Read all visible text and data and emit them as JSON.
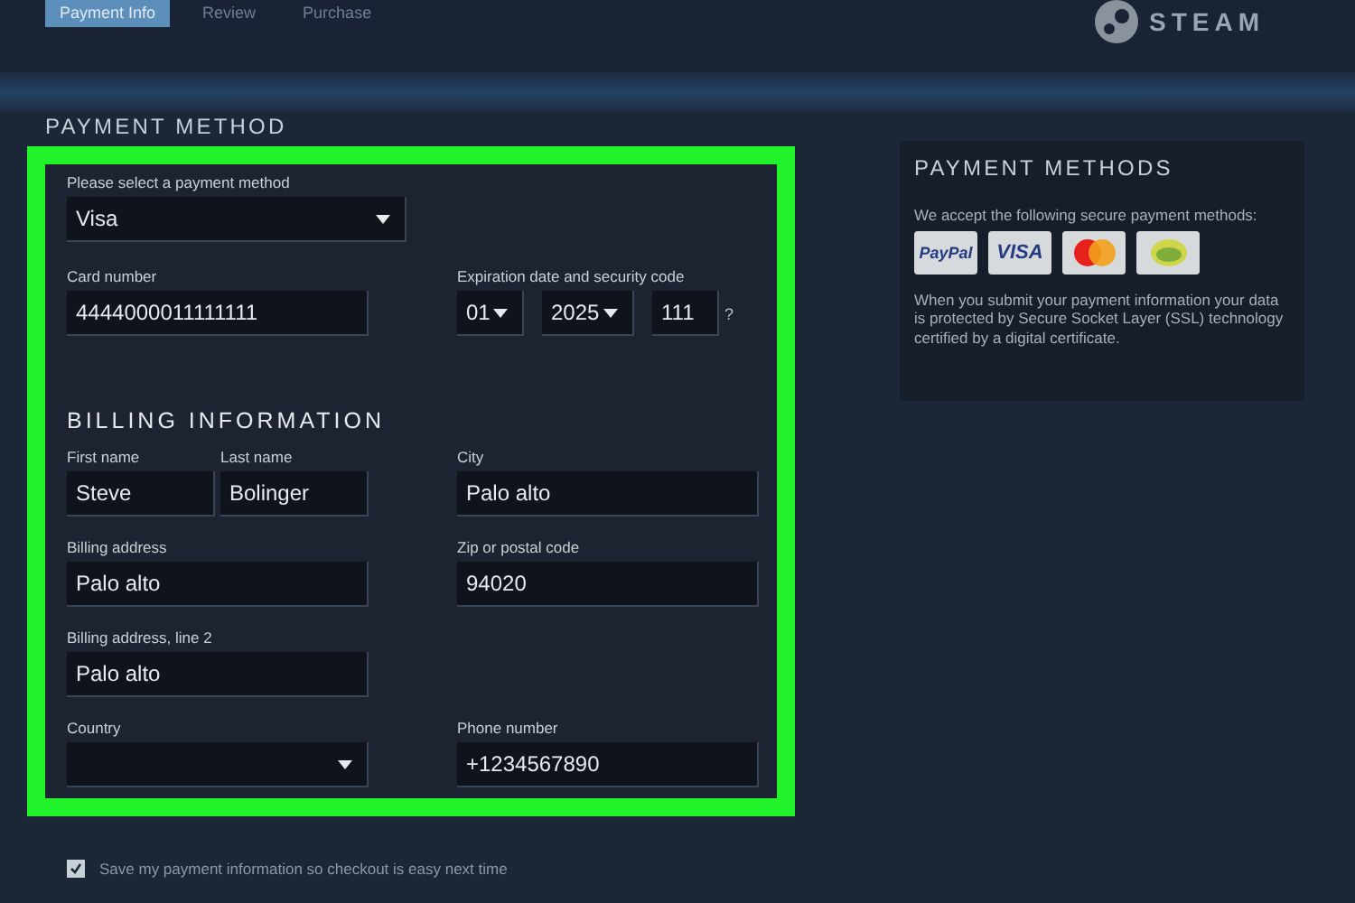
{
  "header": {
    "tabs": [
      {
        "label": "Payment Info",
        "selected": true
      },
      {
        "label": "Review",
        "selected": false
      },
      {
        "label": "Purchase",
        "selected": false
      }
    ],
    "logo": "STEAM"
  },
  "payment_method": {
    "title": "PAYMENT METHOD",
    "highlighted": true,
    "select_label": "Please select a payment method",
    "select_value": "Visa",
    "card_label": "Card number",
    "card_number": "4444000011111111",
    "expiry_label": "Expiration date and security code",
    "month": "01",
    "year": "2025",
    "security_code": "111",
    "help": "?"
  },
  "billing": {
    "title": "BILLING INFORMATION",
    "rows": [
      {
        "left": [
          {
            "kind": "input",
            "label": "First name",
            "value": "Steve"
          },
          {
            "kind": "input",
            "label": "Last name",
            "value": "Bolinger"
          }
        ],
        "right": {
          "kind": "input",
          "label": "City",
          "value": "Palo alto"
        }
      },
      {
        "left": [
          {
            "kind": "input",
            "label": "Billing address",
            "value": "Palo alto"
          }
        ],
        "right": {
          "kind": "input",
          "label": "Zip or postal code",
          "value": "94020"
        }
      },
      {
        "left": [
          {
            "kind": "input",
            "label": "Billing address, line 2",
            "value": "Palo alto"
          }
        ]
      },
      {
        "left": [
          {
            "kind": "select",
            "label": "Country"
          }
        ],
        "right": {
          "kind": "input",
          "label": "Phone number",
          "value": "+1234567890"
        }
      }
    ]
  },
  "save": {
    "label": "Save my payment information so checkout is easy next time",
    "checked": true
  },
  "sidebar": {
    "title": "PAYMENT METHODS",
    "intro": "We accept the following secure payment methods:",
    "logos": [
      {
        "kind": "paypal",
        "text": "PayPal"
      },
      {
        "kind": "visa",
        "text": "VISA"
      },
      {
        "kind": "mastercard"
      },
      {
        "kind": "generic"
      }
    ],
    "note": "When you submit your payment information your data is protected by Secure Socket Layer (SSL) technology certified by a digital certificate."
  }
}
